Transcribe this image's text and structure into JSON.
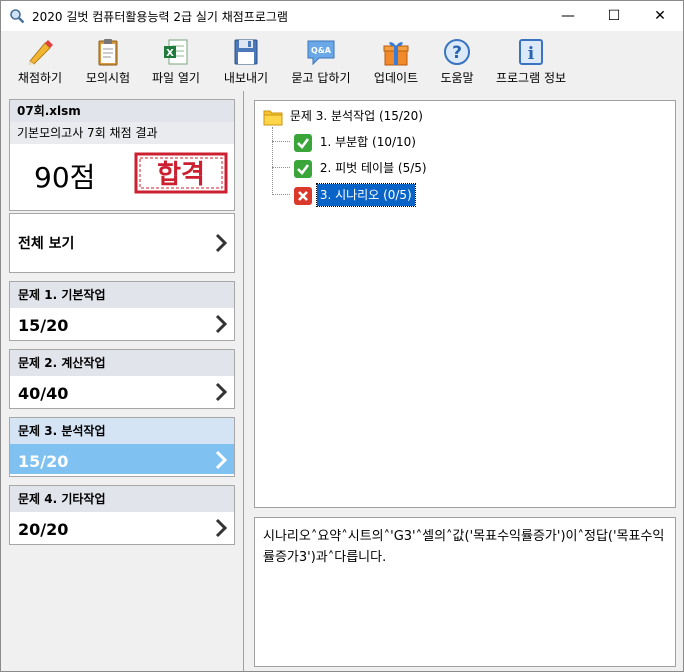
{
  "window": {
    "title": "2020 길벗 컴퓨터활용능력 2급 실기 채점프로그램"
  },
  "window_controls": {
    "minimize": "—",
    "maximize": "☐",
    "close": "✕"
  },
  "toolbar": {
    "items": [
      {
        "label": "채점하기",
        "icon": "pencil-icon"
      },
      {
        "label": "모의시험",
        "icon": "clipboard-icon"
      },
      {
        "label": "파일 열기",
        "icon": "excel-file-icon"
      },
      {
        "label": "내보내기",
        "icon": "floppy-disk-icon"
      },
      {
        "label": "묻고 답하기",
        "icon": "qa-bubble-icon"
      },
      {
        "label": "업데이트",
        "icon": "gift-box-icon"
      },
      {
        "label": "도움말",
        "icon": "help-icon"
      },
      {
        "label": "프로그램 정보",
        "icon": "info-icon"
      }
    ]
  },
  "result": {
    "file": "07회.xlsm",
    "subtitle": "기본모의고사 7회 채점 결과",
    "score": "90점",
    "stamp": "합격"
  },
  "view_all": {
    "label": "전체 보기"
  },
  "questions": [
    {
      "title": "문제 1. 기본작업",
      "score": "15/20",
      "selected": false
    },
    {
      "title": "문제 2. 계산작업",
      "score": "40/40",
      "selected": false
    },
    {
      "title": "문제 3. 분석작업",
      "score": "15/20",
      "selected": true
    },
    {
      "title": "문제 4. 기타작업",
      "score": "20/20",
      "selected": false
    }
  ],
  "tree": {
    "root": "문제 3. 분석작업 (15/20)",
    "children": [
      {
        "label": "1. 부분합 (10/10)",
        "status": "pass"
      },
      {
        "label": "2. 피벗 테이블 (5/5)",
        "status": "pass"
      },
      {
        "label": "3. 시나리오 (0/5)",
        "status": "fail"
      }
    ]
  },
  "message": {
    "text": "시나리오˄요약˄시트의˄'G3'˄셀의˄값('목표수익률증가')이˄정답('목표수익률증가3')과˄다릅니다."
  },
  "colors": {
    "selected": "#7fc2f2",
    "pass": "#3aa63a",
    "fail": "#d9382b",
    "stamp": "#cc2030"
  }
}
